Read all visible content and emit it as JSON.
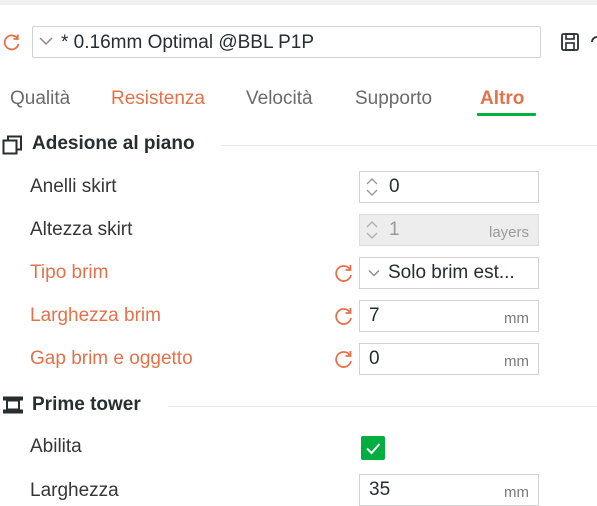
{
  "preset": {
    "name": "* 0.16mm Optimal @BBL P1P"
  },
  "tabs": [
    {
      "label": "Qualità",
      "state": "normal"
    },
    {
      "label": "Resistenza",
      "state": "modified"
    },
    {
      "label": "Velocità",
      "state": "normal"
    },
    {
      "label": "Supporto",
      "state": "normal"
    },
    {
      "label": "Altro",
      "state": "active"
    }
  ],
  "sections": {
    "bed_adhesion": {
      "title": "Adesione al piano",
      "rows": {
        "skirt_loops": {
          "label": "Anelli skirt",
          "value": "0"
        },
        "skirt_height": {
          "label": "Altezza skirt",
          "value": "1",
          "unit": "layers"
        },
        "brim_type": {
          "label": "Tipo brim",
          "value": "Solo brim est..."
        },
        "brim_width": {
          "label": "Larghezza brim",
          "value": "7",
          "unit": "mm"
        },
        "brim_gap": {
          "label": "Gap brim e oggetto",
          "value": "0",
          "unit": "mm"
        }
      }
    },
    "prime_tower": {
      "title": "Prime tower",
      "rows": {
        "enable": {
          "label": "Abilita",
          "checked": true
        },
        "width": {
          "label": "Larghezza",
          "value": "35",
          "unit": "mm"
        }
      }
    }
  },
  "colors": {
    "accent_green": "#00ae42",
    "modified_orange": "#e3724a",
    "text_dark": "#262e30"
  }
}
